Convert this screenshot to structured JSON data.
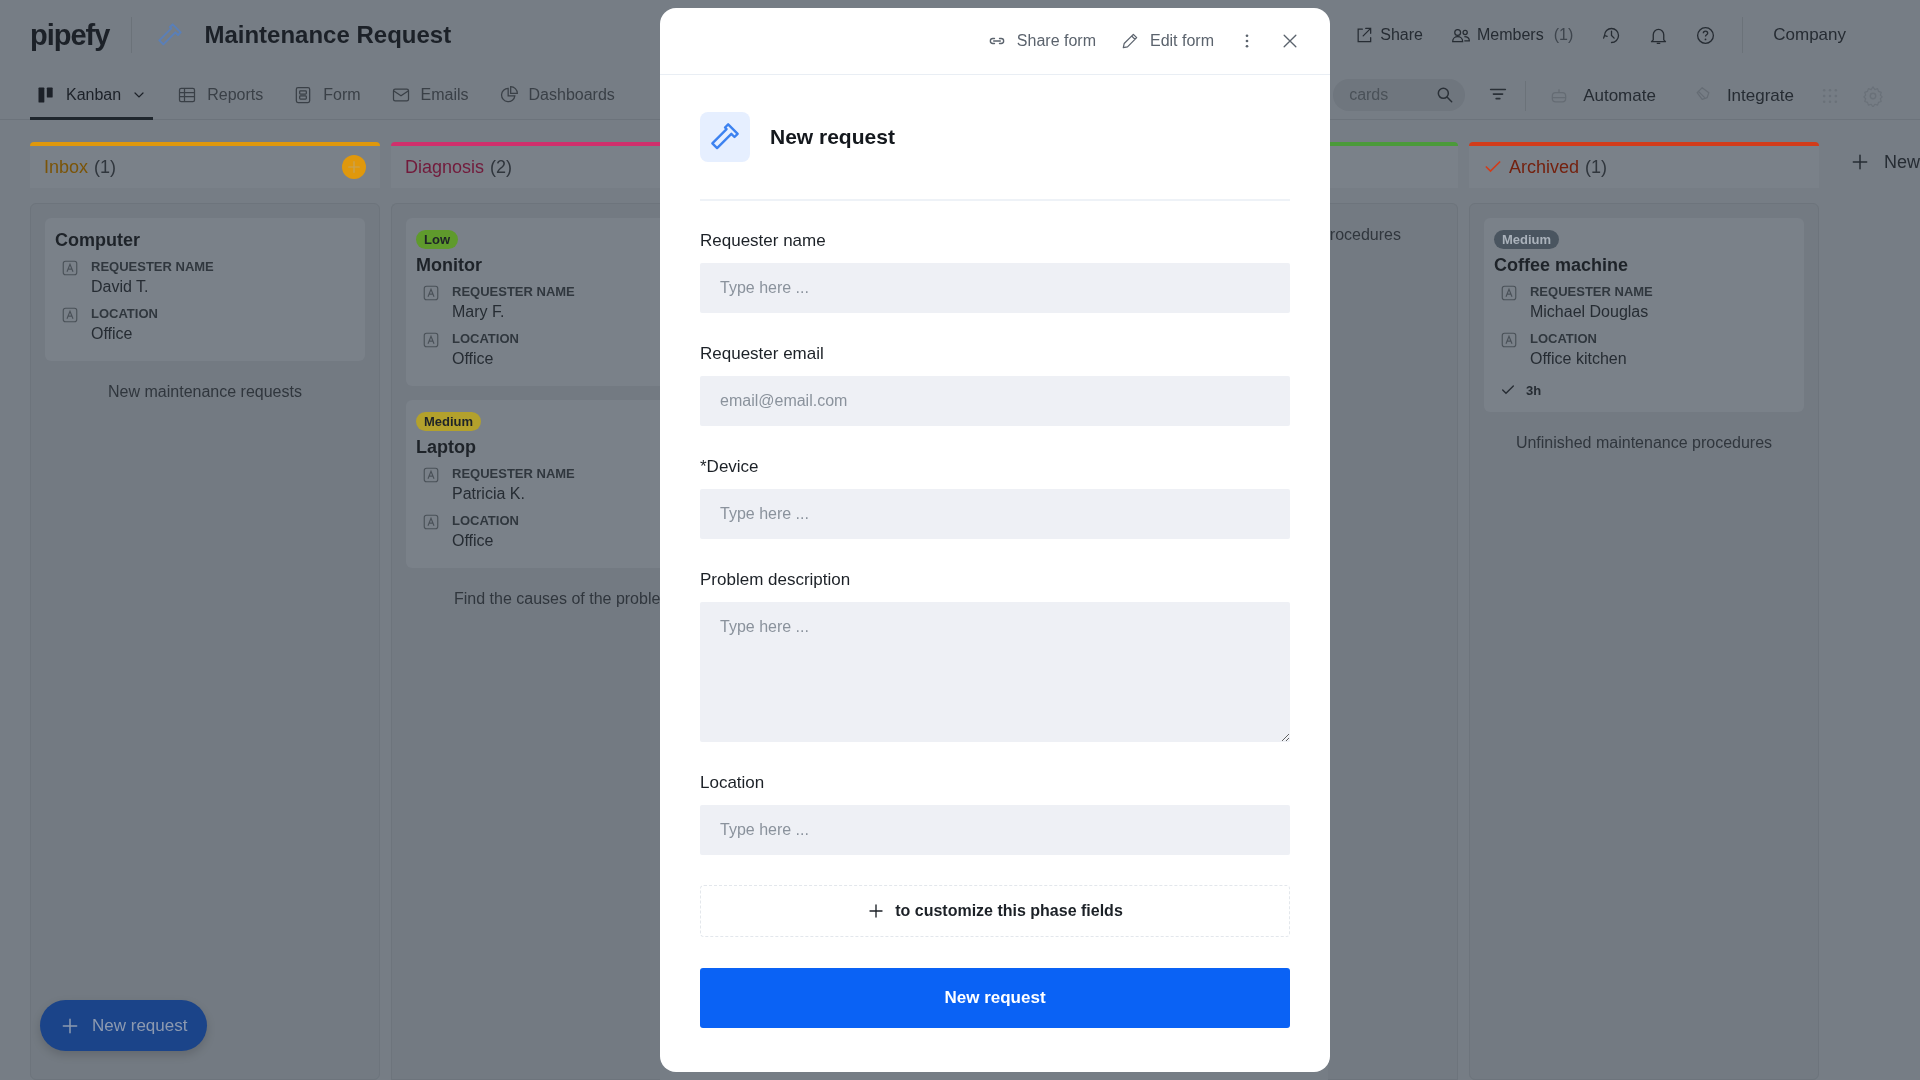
{
  "app": {
    "logo": "pipefy",
    "title": "Maintenance Request"
  },
  "header_actions": [
    {
      "kind": "share",
      "label": "Share"
    },
    {
      "kind": "members",
      "label": "Members",
      "count": "(1)"
    }
  ],
  "account": "Company",
  "views": [
    {
      "kind": "kanban",
      "label": "Kanban",
      "selected": true
    },
    {
      "kind": "reports",
      "label": "Reports",
      "selected": false
    },
    {
      "kind": "form",
      "label": "Form",
      "selected": false
    },
    {
      "kind": "emails",
      "label": "Emails",
      "selected": false
    },
    {
      "kind": "dashboards",
      "label": "Dashboards",
      "selected": false
    }
  ],
  "toolbar": {
    "search_placeholder": "cards",
    "automate": "Automate",
    "integrate": "Integrate"
  },
  "columns": [
    {
      "kind": "full",
      "name": "Inbox",
      "count": "(1)",
      "color": "#e0980c",
      "add_button": true,
      "done": false,
      "footer": "New maintenance requests",
      "cards": [
        {
          "title": "Computer",
          "fields": [
            {
              "label": "REQUESTER NAME",
              "value": "David T."
            },
            {
              "label": "LOCATION",
              "value": "Office"
            }
          ]
        }
      ]
    },
    {
      "kind": "clipped_right",
      "name": "Diagnosis",
      "count": "(2)",
      "color": "#d0306c",
      "add_button": false,
      "done": false,
      "footer": "Find the causes of the proble",
      "cards": [
        {
          "tag": {
            "label": "Low",
            "color": "#5f9a2c"
          },
          "title": "Monitor",
          "fields": [
            {
              "label": "REQUESTER NAME",
              "value": "Mary F."
            },
            {
              "label": "LOCATION",
              "value": "Office"
            }
          ]
        },
        {
          "tag": {
            "label": "Medium",
            "color": "#b3a12c"
          },
          "title": "Laptop",
          "fields": [
            {
              "label": "REQUESTER NAME",
              "value": "Patricia K."
            },
            {
              "label": "LOCATION",
              "value": "Office"
            }
          ]
        }
      ]
    },
    {
      "kind": "clipped_left",
      "color": "#4b9a3a",
      "add_button": false,
      "done": false,
      "footer": "rocedures"
    },
    {
      "kind": "full",
      "name": "Archived",
      "count": "(1)",
      "color": "#d23c1a",
      "add_button": false,
      "done": true,
      "footer": "Unfinished maintenance procedures",
      "cards": [
        {
          "tag": {
            "label": "Medium",
            "color": "#4a5560"
          },
          "title": "Coffee machine",
          "fields": [
            {
              "label": "REQUESTER NAME",
              "value": "Michael Douglas"
            },
            {
              "label": "LOCATION",
              "value": "Office kitchen"
            }
          ],
          "duration": "3h"
        }
      ]
    }
  ],
  "add_phase": "New",
  "fab": "New request",
  "modal": {
    "actions": [
      {
        "kind": "link",
        "label": "Share form"
      },
      {
        "kind": "pencil",
        "label": "Edit form"
      }
    ],
    "title": "New request",
    "fields": [
      {
        "kind": "input",
        "label": "Requester name",
        "placeholder": "Type here ..."
      },
      {
        "kind": "input",
        "label": "Requester email",
        "placeholder": "email@email.com"
      },
      {
        "kind": "input",
        "label": "*Device",
        "placeholder": "Type here ..."
      },
      {
        "kind": "textarea",
        "label": "Problem description",
        "placeholder": "Type here ..."
      },
      {
        "kind": "input",
        "label": "Location",
        "placeholder": "Type here ..."
      }
    ],
    "customize": "to customize this phase fields",
    "submit": "New request"
  }
}
